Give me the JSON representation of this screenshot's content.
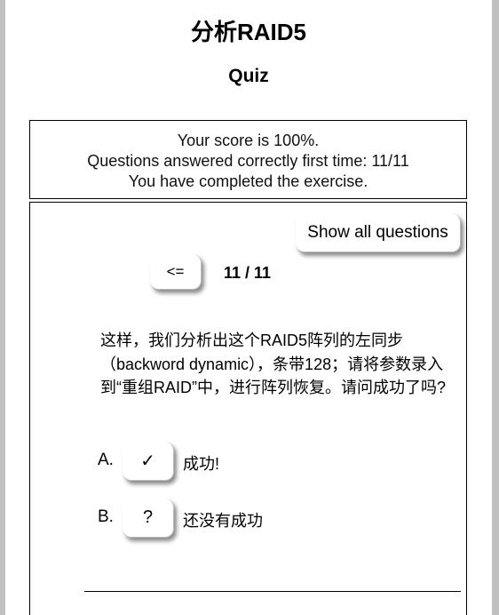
{
  "header": {
    "title": "分析RAID5",
    "subtitle": "Quiz"
  },
  "score": {
    "line1": "Your score is 100%.",
    "line2": "Questions answered correctly first time: 11/11",
    "line3": "You have completed the exercise."
  },
  "quiz": {
    "show_all_label": "Show all questions",
    "prev_label": "<=",
    "counter": "11 / 11",
    "question": "这样，我们分析出这个RAID5阵列的左同步（backword dynamic），条带128；请将参数录入到“重组RAID”中，进行阵列恢复。请问成功了吗?",
    "options": [
      {
        "letter": "A.",
        "mark": "✓",
        "text": "成功!"
      },
      {
        "letter": "B.",
        "mark": "?",
        "text": "还没有成功"
      }
    ]
  },
  "colors": {
    "background": "#c0c0c0",
    "panel": "#ffffff",
    "border": "#000000"
  }
}
